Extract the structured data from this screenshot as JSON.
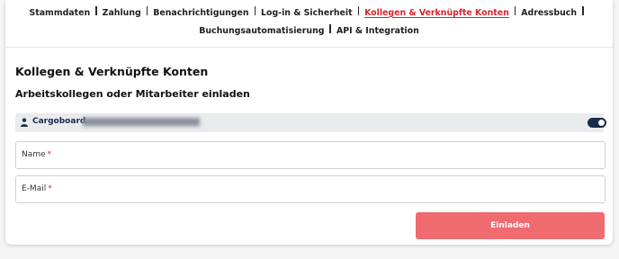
{
  "nav": {
    "row1": [
      {
        "label": "Stammdaten",
        "active": false
      },
      {
        "label": "Zahlung",
        "active": false
      },
      {
        "label": "Benachrichtigungen",
        "active": false
      },
      {
        "label": "Log-in & Sicherheit",
        "active": false
      },
      {
        "label": "Kollegen & Verknüpfte Konten",
        "active": true
      },
      {
        "label": "Adressbuch",
        "active": false
      }
    ],
    "row2": [
      {
        "label": "Buchungsautomatisierung",
        "active": false
      },
      {
        "label": "API & Integration",
        "active": false
      }
    ]
  },
  "page": {
    "title": "Kollegen & Verknüpfte Konten",
    "subtitle": "Arbeitskollegen oder Mitarbeiter einladen"
  },
  "member": {
    "icon": "user-icon",
    "name": "Cargoboard",
    "toggle_on": true
  },
  "form": {
    "name_label": "Name",
    "email_label": "E-Mail",
    "required_mark": "*",
    "submit_label": "Einladen"
  },
  "colors": {
    "accent": "#d8232a",
    "button": "#ef6b6f",
    "toggle": "#1a2b4c",
    "member_bar": "#e9ebee"
  }
}
